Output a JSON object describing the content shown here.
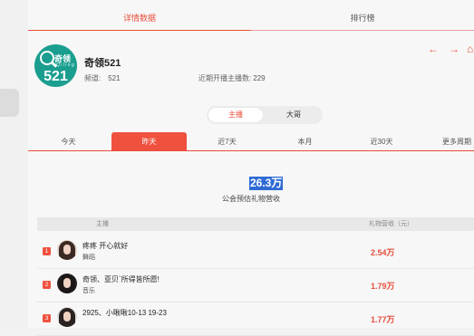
{
  "tabs": [
    {
      "label": "详情数据"
    },
    {
      "label": "排行榜"
    }
  ],
  "profile": {
    "logo_text": "奇领",
    "logo_sub": "Q i l i n g",
    "logo_number": "521",
    "name": "奇领521",
    "channel_label": "频道:",
    "channel_value": "521",
    "recent_label": "近期开播主播数:",
    "recent_value": "229"
  },
  "nav": {
    "back": "←",
    "forward": "→",
    "home": "⌂"
  },
  "segment": [
    {
      "label": "主播"
    },
    {
      "label": "大哥"
    }
  ],
  "periods": [
    {
      "label": "今天"
    },
    {
      "label": "昨天"
    },
    {
      "label": "近7天"
    },
    {
      "label": "本月"
    },
    {
      "label": "近30天"
    },
    {
      "label": "更多周期"
    }
  ],
  "active_period": 1,
  "stats": {
    "value": "26.3万",
    "label": "公会预估礼物营收"
  },
  "table": {
    "columns": [
      "主播",
      "礼物营收（元）"
    ],
    "rows": [
      {
        "rank": "1",
        "name": "疼疼 开心就好",
        "category": "舞蹈",
        "value": "2.54万",
        "hair": "#3b2a24"
      },
      {
        "rank": "2",
        "name": "奇领、亚贝`所得皆所愿!",
        "category": "音乐",
        "value": "1.79万",
        "hair": "#1d1717"
      },
      {
        "rank": "3",
        "name": "2925、小啾啾10-13 19-23",
        "category": "",
        "value": "1.77万",
        "hair": "#2a2220"
      }
    ]
  },
  "colors": {
    "accent": "#e94e3c",
    "teal": "#1b9e8f",
    "highlight": "#2f6bd4"
  }
}
